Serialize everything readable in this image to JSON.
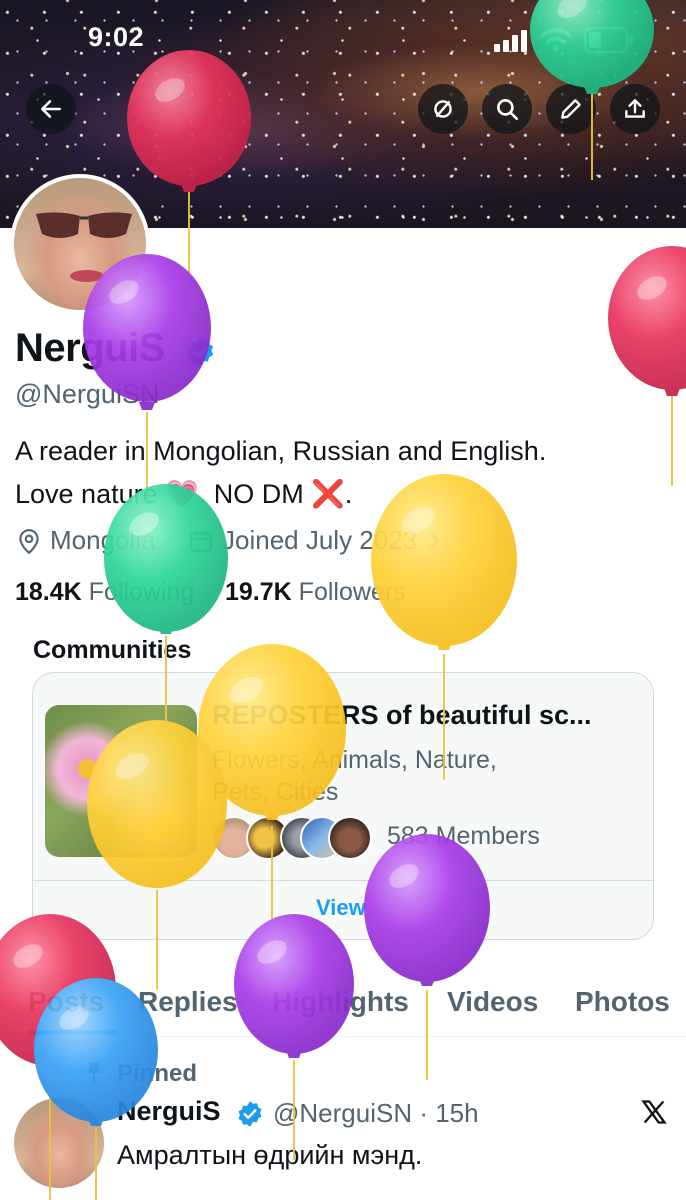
{
  "status_bar": {
    "time": "9:02"
  },
  "profile": {
    "name": "NerguiS",
    "handle": "@NerguiSN",
    "bio_line1": "A reader in Mongolian, Russian and English.",
    "bio_line2": "Love nature 💗. NO DM ❌.",
    "location": "Mongolia",
    "joined": "Joined July 2023",
    "following_count": "18.4K",
    "following_label": "Following",
    "followers_count": "19.7K",
    "followers_label": "Followers"
  },
  "communities": {
    "title": "Communities",
    "name": "REPOSTERS of beautiful sc...",
    "description": "Flowers, Animals, Nature, Pets, Cities",
    "members": "583 Members",
    "view_label": "View"
  },
  "tabs": [
    "Posts",
    "Replies",
    "Highlights",
    "Videos",
    "Photos"
  ],
  "post": {
    "pinned_label": "Pinned",
    "author": "NerguiS",
    "handle_time": "@NerguiSN · 15h",
    "text": "Амралтын өдрийн мэнд."
  },
  "icons": [
    "back-arrow-icon",
    "mute-icon",
    "search-icon",
    "edit-pencil-icon",
    "share-icon",
    "verified-badge-icon",
    "location-pin-icon",
    "calendar-icon",
    "chevron-right-icon",
    "pin-icon",
    "x-logo-icon",
    "signal-icon",
    "wifi-icon",
    "battery-icon"
  ],
  "colors": {
    "accent": "#1d9bf0",
    "text": "#0f1419",
    "muted": "#536471"
  }
}
